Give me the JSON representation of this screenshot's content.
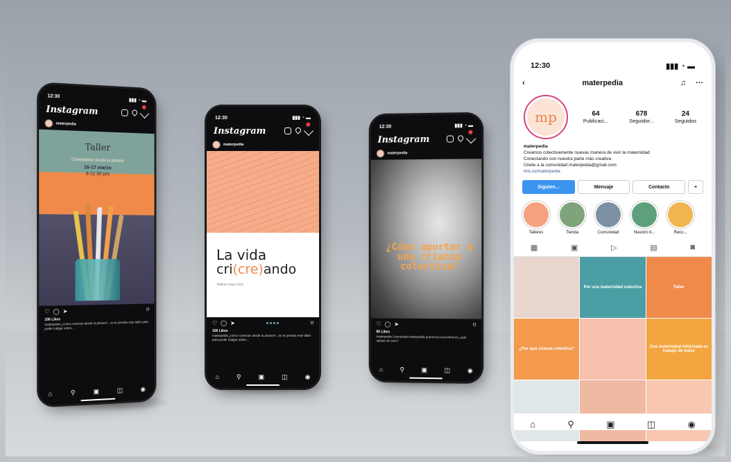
{
  "phones": {
    "p1": {
      "time": "12:30",
      "app": "Instagram",
      "user": "materpedia",
      "post": {
        "title": "Taller",
        "subtitle": "Conectando desde la pintura",
        "dates": "16-17 marzo",
        "hours": "8-11:30 pm"
      },
      "likes": "106 Likes",
      "caption": "materpedia ¿cómo conectar desde la pintura?...no te pierdas este taller para poder indigar sobre..."
    },
    "p2": {
      "time": "12:30",
      "app": "Instagram",
      "user": "materpedia",
      "post": {
        "line1": "La vida",
        "line2_pre": "cri",
        "line2_acc": "(cre)",
        "line2_post": "ando",
        "line3": "Talleres mayo 2022"
      },
      "likes": "106 Likes",
      "caption": "materpedia ¿cómo conectar desde la pintura?...no te pierdas este taller para poder indigar sobre..."
    },
    "p3": {
      "time": "12:30",
      "app": "Instagram",
      "user": "materpedia",
      "post": {
        "question": "¿Cómo aportar a una crianza colectiva?"
      },
      "likes": "80 Likes",
      "caption": "materpedia Comunidad materpedia queremos escucharnos ¿qué opinan de esto?"
    },
    "p4": {
      "time": "12:30",
      "username": "materpedia",
      "avatar_text": "mp",
      "stats": [
        {
          "value": "64",
          "label": "Publicaci..."
        },
        {
          "value": "678",
          "label": "Seguidor..."
        },
        {
          "value": "24",
          "label": "Seguidos"
        }
      ],
      "bio": {
        "name": "materpedia",
        "line1": "Creamos colectivamente nuevas manera de vivir la maternidad",
        "line2": "Conectando con nuestra parte más creativa",
        "line3": "Únete a la comunidad materpedia@gmail.com",
        "link": "link.co/materpedia"
      },
      "buttons": {
        "follow": "Siguien...",
        "message": "Mensaje",
        "contact": "Contacto"
      },
      "highlights": [
        {
          "label": "Talleres",
          "color": "#f5a27f"
        },
        {
          "label": "Tienda",
          "color": "#7fa37a"
        },
        {
          "label": "Comunidad",
          "color": "#7d8fa3"
        },
        {
          "label": "Nuestro li...",
          "color": "#5fa07c"
        },
        {
          "label": "Reco...",
          "color": "#f2b44e"
        }
      ],
      "grid": [
        {
          "text": "",
          "bg": "#e9d6cf"
        },
        {
          "text": "Por una maternidad colectiva",
          "bg": "#4b9ea4"
        },
        {
          "text": "Taller",
          "bg": "#f08a4b"
        },
        {
          "text": "¿Por qué crianza colectiva?",
          "bg": "#f39a4f"
        },
        {
          "text": "",
          "bg": "#f6c0ad"
        },
        {
          "text": "Una maternidad informada es trabajo de todxs",
          "bg": "#f3a53f"
        },
        {
          "text": "",
          "bg": "#dfe7ea"
        },
        {
          "text": "",
          "bg": "#f0b9a2"
        },
        {
          "text": "",
          "bg": "#f7c7b0"
        }
      ]
    }
  }
}
